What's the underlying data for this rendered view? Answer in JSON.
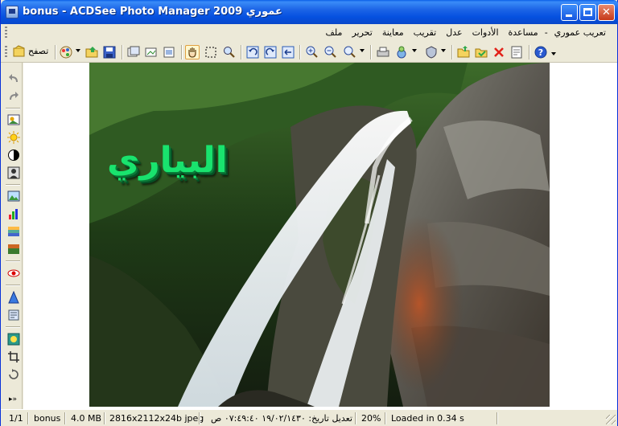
{
  "window": {
    "title": "bonus - ACDSee Photo Manager 2009 عموري"
  },
  "title_buttons": {
    "minimize": "minimize",
    "maximize": "maximize",
    "close": "✕"
  },
  "menu": {
    "items": [
      "ملف",
      "تحرير",
      "معاينة",
      "تقريب",
      "عدل",
      "الأدوات",
      "مساعدة",
      "-",
      "تعريب عموري"
    ]
  },
  "toolbar": {
    "sharpen_label": "تصفح",
    "icons": [
      "browse-icon",
      "edit-icon",
      "open-folder-icon",
      "save-icon",
      "copy-to-icon",
      "move-to-icon",
      "export-icon",
      "hand-icon",
      "select-icon",
      "zoom-lens-icon",
      "rotate-left-icon",
      "rotate-right-icon",
      "flip-icon",
      "zoom-in-icon",
      "zoom-out-icon",
      "zoom-menu-icon",
      "print-icon",
      "color-icon",
      "protect-icon",
      "open-icon",
      "acquire-icon",
      "delete-icon",
      "properties-icon",
      "help-icon"
    ]
  },
  "left_tools": [
    "undo-icon",
    "redo-icon",
    "auto-adjust-icon",
    "exposure-icon",
    "contrast-icon",
    "grayscale-icon",
    "image-icon",
    "levels-icon",
    "curves-icon",
    "color-balance-icon",
    "red-eye-icon",
    "sharpen-icon",
    "text-icon",
    "effects-icon",
    "crop-icon",
    "rotate-icon"
  ],
  "image": {
    "overlay_text": "البياري"
  },
  "status": {
    "index": "1/1",
    "folder": "bonus",
    "size": "4.0 MB",
    "dimensions": "2816x2112x24b jpeg",
    "modified": "تعديل تاريخ: ١٩/٠٢/١٤٣٠ ٠٧:٤٩:٤٠ ص",
    "zoom": "20%",
    "load_time": "Loaded in 0.34 s"
  },
  "colors": {
    "titlebar": "#0551e0",
    "chrome": "#ece9d8",
    "overlay_text": "#19e36e"
  }
}
